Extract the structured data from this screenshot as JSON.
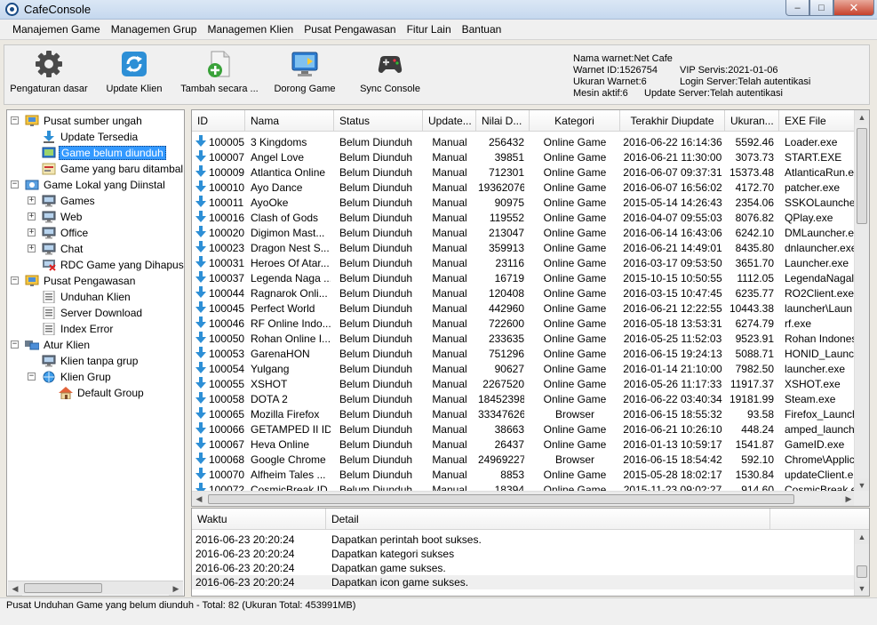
{
  "window": {
    "title": "CafeConsole",
    "min": "–",
    "max": "□",
    "close": "✕"
  },
  "menu": [
    "Manajemen Game",
    "Managemen Grup",
    "Managemen Klien",
    "Pusat Pengawasan",
    "Fitur Lain",
    "Bantuan"
  ],
  "toolbar": [
    {
      "label": "Pengaturan dasar",
      "icon": "gear-icon"
    },
    {
      "label": "Update Klien",
      "icon": "refresh-icon"
    },
    {
      "label": "Tambah secara ...",
      "icon": "add-file-icon"
    },
    {
      "label": "Dorong Game",
      "icon": "push-game-icon"
    },
    {
      "label": "Sync Console",
      "icon": "gamepad-icon"
    }
  ],
  "info": {
    "warnet_name": "Nama warnet:Net Cafe",
    "warnet_id": "Warnet ID:1526754",
    "vip": "VIP Servis:2021-01-06",
    "ukuran": "Ukuran Warnet:6",
    "login_server": "Login Server:Telah autentikasi",
    "mesin": "Mesin aktif:6",
    "update_server": "Update Server:Telah autentikasi"
  },
  "tree": [
    {
      "label": "Pusat sumber ungah",
      "level": 0,
      "expander": "−",
      "icon": "monitor-folder-icon"
    },
    {
      "label": "Update Tersedia",
      "level": 1,
      "icon": "download-icon"
    },
    {
      "label": "Game belum diunduh",
      "level": 1,
      "icon": "game-icon",
      "selected": true
    },
    {
      "label": "Game yang baru ditambal",
      "level": 1,
      "icon": "patch-icon"
    },
    {
      "label": "Game Lokal yang Diinstal",
      "level": 0,
      "expander": "−",
      "icon": "local-games-icon"
    },
    {
      "label": "Games",
      "level": 1,
      "expander": "+",
      "icon": "monitor-icon"
    },
    {
      "label": "Web",
      "level": 1,
      "expander": "+",
      "icon": "monitor-icon"
    },
    {
      "label": "Office",
      "level": 1,
      "expander": "+",
      "icon": "monitor-icon"
    },
    {
      "label": "Chat",
      "level": 1,
      "expander": "+",
      "icon": "monitor-icon"
    },
    {
      "label": "RDC Game yang Dihapus",
      "level": 1,
      "icon": "deleted-icon"
    },
    {
      "label": "Pusat Pengawasan",
      "level": 0,
      "expander": "−",
      "icon": "monitor-folder-icon"
    },
    {
      "label": "Unduhan Klien",
      "level": 1,
      "icon": "list-icon"
    },
    {
      "label": "Server Download",
      "level": 1,
      "icon": "list-icon"
    },
    {
      "label": "Index Error",
      "level": 1,
      "icon": "list-icon"
    },
    {
      "label": "Atur Klien",
      "level": 0,
      "expander": "−",
      "icon": "clients-icon"
    },
    {
      "label": "Klien tanpa grup",
      "level": 1,
      "icon": "monitor-icon"
    },
    {
      "label": "Klien Grup",
      "level": 1,
      "expander": "−",
      "icon": "globe-icon"
    },
    {
      "label": "Default Group",
      "level": 2,
      "icon": "house-icon"
    }
  ],
  "grid": {
    "columns": [
      "ID",
      "Nama",
      "Status",
      "Update...",
      "Nilai D...",
      "Kategori",
      "Terakhir Diupdate",
      "Ukuran...",
      "EXE File"
    ],
    "rows": [
      [
        "100005",
        "3 Kingdoms",
        "Belum Diunduh",
        "Manual",
        "256432",
        "Online Game",
        "2016-06-22 16:14:36",
        "5592.46",
        "Loader.exe"
      ],
      [
        "100007",
        "Angel Love",
        "Belum Diunduh",
        "Manual",
        "39851",
        "Online Game",
        "2016-06-21 11:30:00",
        "3073.73",
        "START.EXE"
      ],
      [
        "100009",
        "Atlantica Online",
        "Belum Diunduh",
        "Manual",
        "712301",
        "Online Game",
        "2016-06-07 09:37:31",
        "15373.48",
        "AtlanticaRun.ex"
      ],
      [
        "100010",
        "Ayo Dance",
        "Belum Diunduh",
        "Manual",
        "19362076",
        "Online Game",
        "2016-06-07 16:56:02",
        "4172.70",
        "patcher.exe"
      ],
      [
        "100011",
        "AyoOke",
        "Belum Diunduh",
        "Manual",
        "90975",
        "Online Game",
        "2015-05-14 14:26:43",
        "2354.06",
        "SSKOLauncher"
      ],
      [
        "100016",
        "Clash of Gods",
        "Belum Diunduh",
        "Manual",
        "119552",
        "Online Game",
        "2016-04-07 09:55:03",
        "8076.82",
        "QPlay.exe"
      ],
      [
        "100020",
        "Digimon Mast...",
        "Belum Diunduh",
        "Manual",
        "213047",
        "Online Game",
        "2016-06-14 16:43:06",
        "6242.10",
        "DMLauncher.ex"
      ],
      [
        "100023",
        "Dragon Nest S...",
        "Belum Diunduh",
        "Manual",
        "359913",
        "Online Game",
        "2016-06-21 14:49:01",
        "8435.80",
        "dnlauncher.exe"
      ],
      [
        "100031",
        "Heroes Of Atar...",
        "Belum Diunduh",
        "Manual",
        "23116",
        "Online Game",
        "2016-03-17 09:53:50",
        "3651.70",
        "Launcher.exe"
      ],
      [
        "100037",
        "Legenda Naga ...",
        "Belum Diunduh",
        "Manual",
        "16719",
        "Online Game",
        "2015-10-15 10:50:55",
        "1112.05",
        "LegendaNagal"
      ],
      [
        "100044",
        "Ragnarok Onli...",
        "Belum Diunduh",
        "Manual",
        "120408",
        "Online Game",
        "2016-03-15 10:47:45",
        "6235.77",
        "RO2Client.exe"
      ],
      [
        "100045",
        "Perfect World",
        "Belum Diunduh",
        "Manual",
        "442960",
        "Online Game",
        "2016-06-21 12:22:55",
        "10443.38",
        "launcher\\Laun"
      ],
      [
        "100046",
        "RF Online Indo...",
        "Belum Diunduh",
        "Manual",
        "722600",
        "Online Game",
        "2016-05-18 13:53:31",
        "6274.79",
        "rf.exe"
      ],
      [
        "100050",
        "Rohan Online I...",
        "Belum Diunduh",
        "Manual",
        "233635",
        "Online Game",
        "2016-05-25 11:52:03",
        "9523.91",
        "Rohan Indones"
      ],
      [
        "100053",
        "GarenaHON",
        "Belum Diunduh",
        "Manual",
        "751296",
        "Online Game",
        "2016-06-15 19:24:13",
        "5088.71",
        "HONID_Launch"
      ],
      [
        "100054",
        "Yulgang",
        "Belum Diunduh",
        "Manual",
        "90627",
        "Online Game",
        "2016-01-14 21:10:00",
        "7982.50",
        "launcher.exe"
      ],
      [
        "100055",
        "XSHOT",
        "Belum Diunduh",
        "Manual",
        "2267520",
        "Online Game",
        "2016-05-26 11:17:33",
        "11917.37",
        "XSHOT.exe"
      ],
      [
        "100058",
        "DOTA 2",
        "Belum Diunduh",
        "Manual",
        "18452398",
        "Online Game",
        "2016-06-22 03:40:34",
        "19181.99",
        "Steam.exe"
      ],
      [
        "100065",
        "Mozilla Firefox",
        "Belum Diunduh",
        "Manual",
        "33347626",
        "Browser",
        "2016-06-15 18:55:32",
        "93.58",
        "Firefox_Launch"
      ],
      [
        "100066",
        "GETAMPED II ID",
        "Belum Diunduh",
        "Manual",
        "38663",
        "Online Game",
        "2016-06-21 10:26:10",
        "448.24",
        "amped_launch"
      ],
      [
        "100067",
        "Heva Online",
        "Belum Diunduh",
        "Manual",
        "26437",
        "Online Game",
        "2016-01-13 10:59:17",
        "1541.87",
        "GameID.exe"
      ],
      [
        "100068",
        "Google Chrome",
        "Belum Diunduh",
        "Manual",
        "24969227",
        "Browser",
        "2016-06-15 18:54:42",
        "592.10",
        "Chrome\\Applic"
      ],
      [
        "100070",
        "Alfheim Tales ...",
        "Belum Diunduh",
        "Manual",
        "8853",
        "Online Game",
        "2015-05-28 18:02:17",
        "1530.84",
        "updateClient.e"
      ],
      [
        "100072",
        "CosmicBreak ID",
        "Belum Diunduh",
        "Manual",
        "18394",
        "Online Game",
        "2015-11-23 09:02:27",
        "914.60",
        "CosmicBreak.e"
      ]
    ]
  },
  "log": {
    "columns": [
      "Waktu",
      "Detail"
    ],
    "rows": [
      [
        "2016-06-23 20:20:24",
        "Dapatkan perintah boot sukses."
      ],
      [
        "2016-06-23 20:20:24",
        "Dapatkan kategori sukses"
      ],
      [
        "2016-06-23 20:20:24",
        "Dapatkan game sukses."
      ],
      [
        "2016-06-23 20:20:24",
        "Dapatkan icon game sukses."
      ]
    ]
  },
  "status": "Pusat Unduhan Game yang belum diunduh - Total: 82 (Ukuran Total: 453991MB)"
}
